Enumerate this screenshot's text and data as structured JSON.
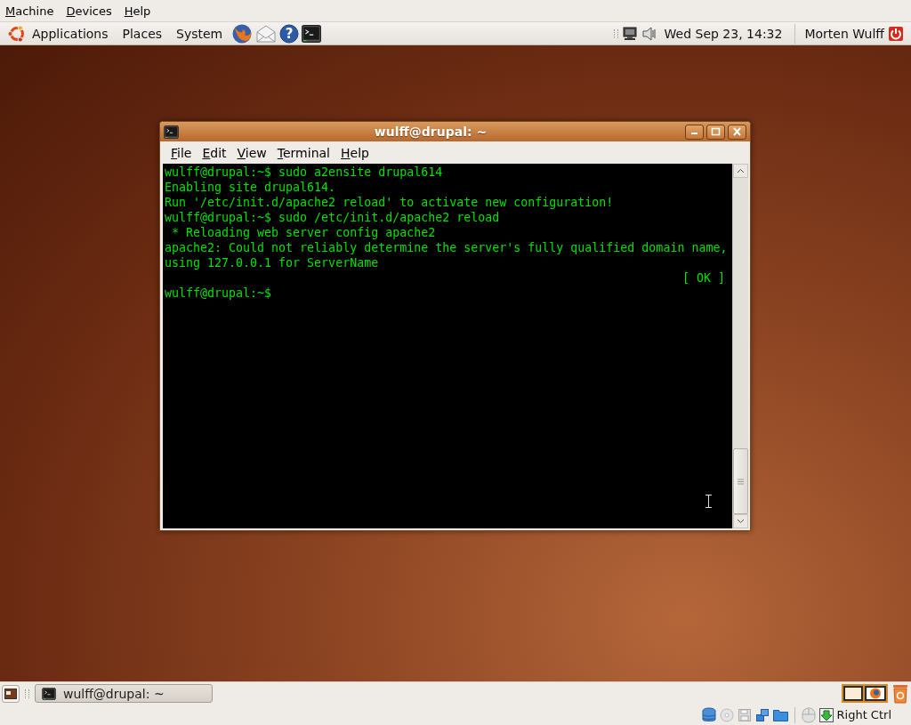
{
  "vm_menu": [
    {
      "label": "Machine"
    },
    {
      "label": "Devices"
    },
    {
      "label": "Help"
    }
  ],
  "top_panel": {
    "menus": [
      "Applications",
      "Places",
      "System"
    ],
    "help_glyph": "?",
    "clock": "Wed Sep 23, 14:32",
    "user": "Morten Wulff"
  },
  "window": {
    "title": "wulff@drupal: ~",
    "menu": [
      "File",
      "Edit",
      "View",
      "Terminal",
      "Help"
    ],
    "lines": [
      {
        "kind": "line",
        "text": "wulff@drupal:~$ sudo a2ensite drupal614"
      },
      {
        "kind": "line",
        "text": "Enabling site drupal614."
      },
      {
        "kind": "line",
        "text": "Run '/etc/init.d/apache2 reload' to activate new configuration!"
      },
      {
        "kind": "line",
        "text": "wulff@drupal:~$ sudo /etc/init.d/apache2 reload"
      },
      {
        "kind": "line",
        "text": " * Reloading web server config apache2"
      },
      {
        "kind": "line",
        "text": "apache2: Could not reliably determine the server's fully qualified domain name,"
      },
      {
        "kind": "line",
        "text": "using 127.0.0.1 for ServerName"
      },
      {
        "kind": "right",
        "text": "[ OK ]"
      },
      {
        "kind": "line",
        "text": "wulff@drupal:~$"
      }
    ]
  },
  "taskbar": [
    {
      "label": "wulff@drupal: ~"
    }
  ],
  "status_bar": {
    "host_key": "Right Ctrl"
  }
}
